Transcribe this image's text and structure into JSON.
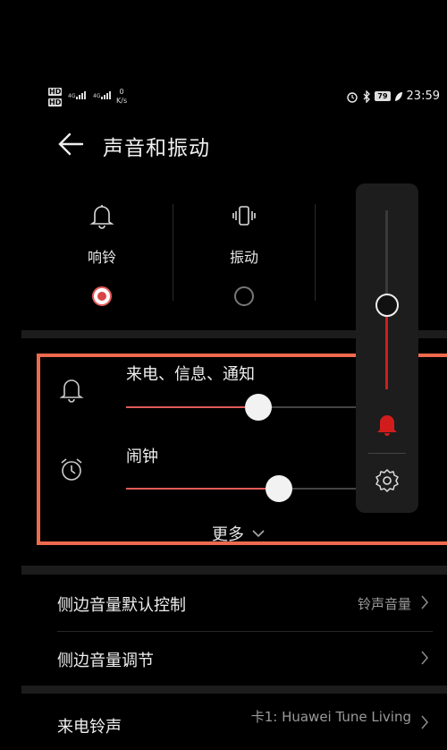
{
  "status_bar": {
    "hd1": "HD",
    "hd2": "HD",
    "net1": "4G",
    "net2": "4G",
    "speed_value": "0",
    "speed_unit": "K/s",
    "battery": "79",
    "time": "23:59"
  },
  "header": {
    "title": "声音和振动"
  },
  "modes": [
    {
      "label": "响铃",
      "selected": true
    },
    {
      "label": "振动",
      "selected": false
    }
  ],
  "sliders": [
    {
      "label": "来电、信息、通知",
      "level_percent": 50
    },
    {
      "label": "闹钟",
      "level_percent": 58
    }
  ],
  "more": {
    "label": "更多"
  },
  "volume_panel": {
    "level_percent": 48,
    "accent": "#d21c1c"
  },
  "list": [
    {
      "name": "侧边音量默认控制",
      "value": "铃声音量"
    },
    {
      "name": "侧边音量调节",
      "value": ""
    },
    {
      "name": "来电铃声",
      "value": "卡1: Huawei Tune Living"
    }
  ],
  "colors": {
    "accent_red": "#e05a58",
    "highlight_border": "#ee6a4e"
  }
}
